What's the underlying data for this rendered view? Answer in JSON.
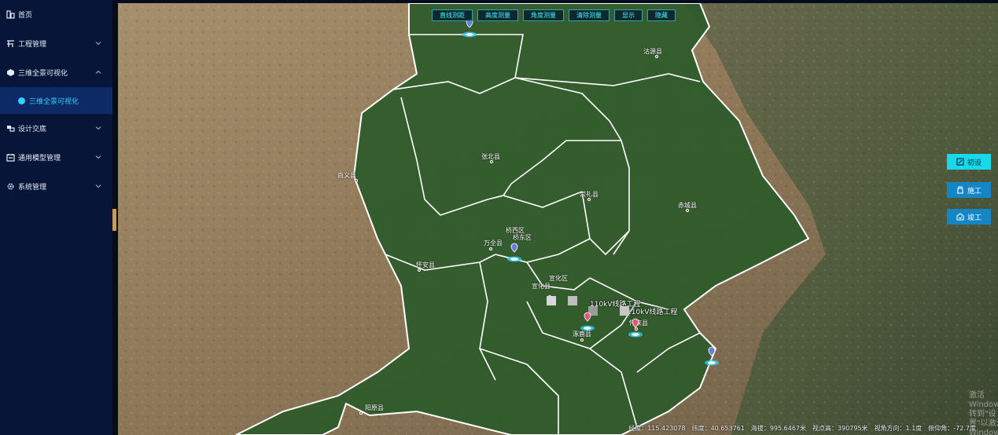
{
  "sidebar": {
    "items": [
      {
        "label": "首页",
        "icon": "home-icon"
      },
      {
        "label": "工程管理",
        "icon": "project-icon"
      },
      {
        "label": "三维全景可视化",
        "icon": "cube-icon"
      },
      {
        "label": "设计交底",
        "icon": "design-icon"
      },
      {
        "label": "通用模型管理",
        "icon": "model-icon"
      },
      {
        "label": "系统管理",
        "icon": "gear-icon"
      }
    ],
    "active_sub": {
      "label": "三维全景可视化"
    }
  },
  "toolbar": {
    "line_measure": "直线测距",
    "height_measure": "高度测量",
    "angle_measure": "角度测量",
    "clear_measure": "清除测量",
    "show": "显示",
    "hide": "隐藏"
  },
  "phases": {
    "initial": "初设",
    "construct": "施工",
    "complete": "竣工"
  },
  "map_labels": {
    "guyuan": "沽源县",
    "zhangbei": "张北县",
    "shangyi": "尚义县",
    "chongli": "崇礼县",
    "chicheng": "赤城县",
    "qiaoxi": "桥西区",
    "qiaodong": "桥东区",
    "wanquan": "万全县",
    "huaian": "怀安县",
    "xuanhua_qu": "宣化区",
    "xuanhua_xian": "宣化县",
    "huailai": "怀来县",
    "zhuolu": "涿鹿县",
    "yangyuan": "阳原县"
  },
  "projects": {
    "p1": "110kV线路工程",
    "p2": "110kV线路工程"
  },
  "status": {
    "lon": "经度：115.423078",
    "lat": "纬度：40.653761",
    "alt": "海拔：995.6467米",
    "view_height": "视点高：390795米",
    "heading": "视角方向：1.1度",
    "pitch": "俯仰角：-72.7度"
  },
  "watermark": {
    "line1": "激活 Windows",
    "line2": "转到\"设置\"以激活 Windows。"
  },
  "colors": {
    "sidebar_bg": "#071638",
    "active_accent": "#2fd3ff",
    "toolbar_text": "#43f0ff",
    "phase_active": "#16d9ec",
    "phase_normal": "#1486c6"
  }
}
